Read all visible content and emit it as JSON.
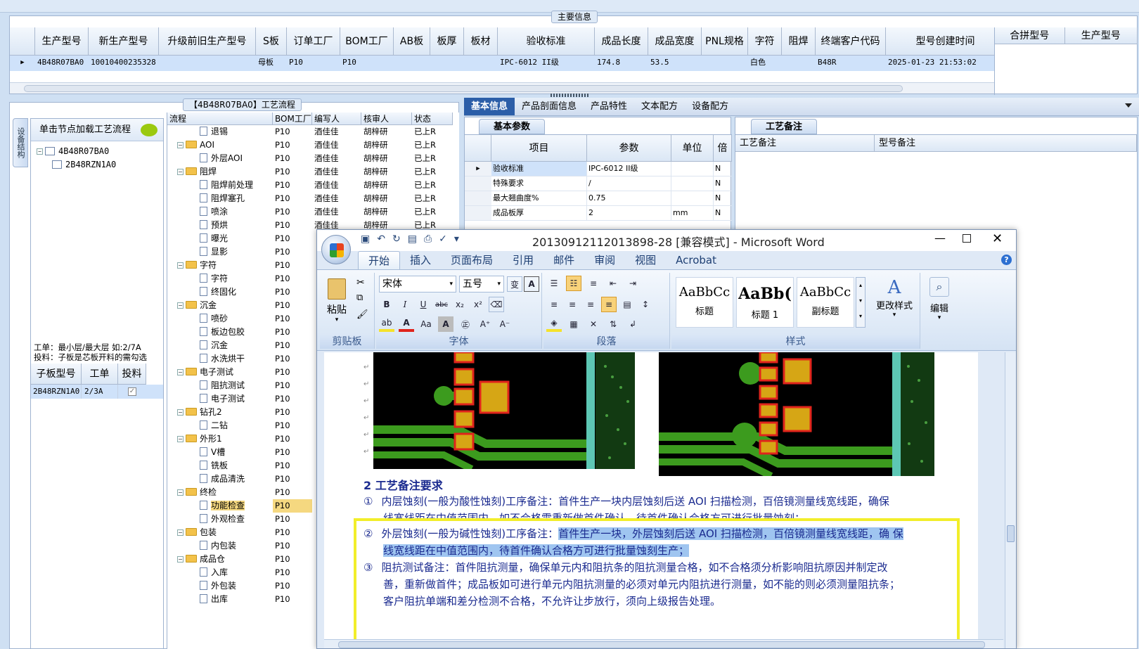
{
  "main_info_title": "主要信息",
  "main_grid": {
    "headers": [
      "生产型号",
      "新生产型号",
      "升级前旧生产型号",
      "S板",
      "订单工厂",
      "BOM工厂",
      "AB板",
      "板厚",
      "板材",
      "验收标准",
      "成品长度",
      "成品宽度",
      "PNL规格",
      "字符",
      "阻焊",
      "终端客户代码",
      "型号创建时间"
    ],
    "row": [
      "4B48R07BA0",
      "10010400235328",
      "",
      "母板",
      "P10",
      "P10",
      "",
      "",
      "",
      "IPC-6012 II级",
      "174.8",
      "53.5",
      "",
      "白色",
      "",
      "B48R",
      "2025-01-23 21:53:02"
    ]
  },
  "merge_grid": {
    "headers": [
      "合拼型号",
      "生产型号"
    ]
  },
  "flow_title": "【4B48R07BA0】工艺流程",
  "side_tab": "设备结构",
  "node_hint": "单击节点加载工艺流程",
  "node_tree": [
    "4B48R07BA0",
    "2B48RZN1A0"
  ],
  "work_note_1": "工单：最小层/最大层 如:2/7A",
  "work_note_2": "投料：子板是芯板开料的需勾选",
  "sub_grid": {
    "headers": [
      "子板型号",
      "工单",
      "投料"
    ],
    "row": [
      "2B48RZN1A0",
      "2/3A"
    ]
  },
  "flow_grid": {
    "headers": [
      "流程",
      "BOM工厂",
      "编写人",
      "核审人",
      "状态"
    ],
    "rows": [
      {
        "level": 2,
        "name": "退锡",
        "bom": "P10",
        "writer": "酒佳佳",
        "reviewer": "胡梓研",
        "status": "已上R"
      },
      {
        "level": 1,
        "name": "AOI",
        "bom": "P10",
        "writer": "酒佳佳",
        "reviewer": "胡梓研",
        "status": "已上R"
      },
      {
        "level": 2,
        "name": "外层AOI",
        "bom": "P10",
        "writer": "酒佳佳",
        "reviewer": "胡梓研",
        "status": "已上R"
      },
      {
        "level": 1,
        "name": "阻焊",
        "bom": "P10",
        "writer": "酒佳佳",
        "reviewer": "胡梓研",
        "status": "已上R"
      },
      {
        "level": 2,
        "name": "阻焊前处理",
        "bom": "P10",
        "writer": "酒佳佳",
        "reviewer": "胡梓研",
        "status": "已上R"
      },
      {
        "level": 2,
        "name": "阻焊塞孔",
        "bom": "P10",
        "writer": "酒佳佳",
        "reviewer": "胡梓研",
        "status": "已上R"
      },
      {
        "level": 2,
        "name": "喷涂",
        "bom": "P10",
        "writer": "酒佳佳",
        "reviewer": "胡梓研",
        "status": "已上R"
      },
      {
        "level": 2,
        "name": "预烘",
        "bom": "P10",
        "writer": "酒佳佳",
        "reviewer": "胡梓研",
        "status": "已上R"
      },
      {
        "level": 2,
        "name": "曝光",
        "bom": "P10",
        "writer": "",
        "reviewer": "",
        "status": ""
      },
      {
        "level": 2,
        "name": "显影",
        "bom": "P10",
        "writer": "",
        "reviewer": "",
        "status": ""
      },
      {
        "level": 1,
        "name": "字符",
        "bom": "P10",
        "writer": "",
        "reviewer": "",
        "status": ""
      },
      {
        "level": 2,
        "name": "字符",
        "bom": "P10",
        "writer": "",
        "reviewer": "",
        "status": ""
      },
      {
        "level": 2,
        "name": "终固化",
        "bom": "P10",
        "writer": "",
        "reviewer": "",
        "status": ""
      },
      {
        "level": 1,
        "name": "沉金",
        "bom": "P10",
        "writer": "",
        "reviewer": "",
        "status": ""
      },
      {
        "level": 2,
        "name": "喷砂",
        "bom": "P10",
        "writer": "",
        "reviewer": "",
        "status": ""
      },
      {
        "level": 2,
        "name": "板边包胶",
        "bom": "P10",
        "writer": "",
        "reviewer": "",
        "status": ""
      },
      {
        "level": 2,
        "name": "沉金",
        "bom": "P10",
        "writer": "",
        "reviewer": "",
        "status": ""
      },
      {
        "level": 2,
        "name": "水洗烘干",
        "bom": "P10",
        "writer": "",
        "reviewer": "",
        "status": ""
      },
      {
        "level": 1,
        "name": "电子测试",
        "bom": "P10",
        "writer": "",
        "reviewer": "",
        "status": ""
      },
      {
        "level": 2,
        "name": "阻抗测试",
        "bom": "P10",
        "writer": "",
        "reviewer": "",
        "status": ""
      },
      {
        "level": 2,
        "name": "电子测试",
        "bom": "P10",
        "writer": "",
        "reviewer": "",
        "status": ""
      },
      {
        "level": 1,
        "name": "钻孔2",
        "bom": "P10",
        "writer": "",
        "reviewer": "",
        "status": ""
      },
      {
        "level": 2,
        "name": "二钻",
        "bom": "P10",
        "writer": "",
        "reviewer": "",
        "status": ""
      },
      {
        "level": 1,
        "name": "外形1",
        "bom": "P10",
        "writer": "",
        "reviewer": "",
        "status": ""
      },
      {
        "level": 2,
        "name": "V槽",
        "bom": "P10",
        "writer": "",
        "reviewer": "",
        "status": ""
      },
      {
        "level": 2,
        "name": "铣板",
        "bom": "P10",
        "writer": "",
        "reviewer": "",
        "status": ""
      },
      {
        "level": 2,
        "name": "成品清洗",
        "bom": "P10",
        "writer": "",
        "reviewer": "",
        "status": ""
      },
      {
        "level": 1,
        "name": "终检",
        "bom": "P10",
        "writer": "",
        "reviewer": "",
        "status": ""
      },
      {
        "level": 2,
        "name": "功能检查",
        "bom": "P10",
        "writer": "",
        "reviewer": "",
        "status": "",
        "selected": true
      },
      {
        "level": 2,
        "name": "外观检查",
        "bom": "P10",
        "writer": "",
        "reviewer": "",
        "status": ""
      },
      {
        "level": 1,
        "name": "包装",
        "bom": "P10",
        "writer": "",
        "reviewer": "",
        "status": ""
      },
      {
        "level": 2,
        "name": "内包装",
        "bom": "P10",
        "writer": "",
        "reviewer": "",
        "status": ""
      },
      {
        "level": 1,
        "name": "成品仓",
        "bom": "P10",
        "writer": "",
        "reviewer": "",
        "status": ""
      },
      {
        "level": 2,
        "name": "入库",
        "bom": "P10",
        "writer": "",
        "reviewer": "",
        "status": ""
      },
      {
        "level": 2,
        "name": "外包装",
        "bom": "P10",
        "writer": "",
        "reviewer": "",
        "status": ""
      },
      {
        "level": 2,
        "name": "出库",
        "bom": "P10",
        "writer": "",
        "reviewer": "",
        "status": ""
      }
    ]
  },
  "right_tabs": [
    "基本信息",
    "产品剖面信息",
    "产品特性",
    "文本配方",
    "设备配方"
  ],
  "basic_params": {
    "title": "基本参数",
    "headers": [
      "项目",
      "参数",
      "单位",
      "倍"
    ],
    "rows": [
      [
        "验收标准",
        "IPC-6012 II级",
        "",
        "N"
      ],
      [
        "特殊要求",
        "/",
        "",
        "N"
      ],
      [
        "最大翘曲度%",
        "0.75",
        "",
        "N"
      ],
      [
        "成品板厚",
        "2",
        "mm",
        "N"
      ]
    ]
  },
  "remarks": {
    "title": "工艺备注",
    "col1": "工艺备注",
    "col2": "型号备注"
  },
  "word": {
    "title": "20130912112013898-28 [兼容模式] - Microsoft Word",
    "ribbon_tabs": [
      "开始",
      "插入",
      "页面布局",
      "引用",
      "邮件",
      "审阅",
      "视图",
      "Acrobat"
    ],
    "font_name": "宋体",
    "font_size": "五号",
    "paste_label": "粘贴",
    "groups": [
      "剪贴板",
      "字体",
      "段落",
      "样式"
    ],
    "styles": [
      {
        "sample": "AaBbCc",
        "label": "标题"
      },
      {
        "sample": "AaBb(",
        "label": "标题 1"
      },
      {
        "sample": "AaBbCc",
        "label": "副标题"
      }
    ],
    "change_style": "更改样式",
    "edit": "编辑",
    "heading": "2 工艺备注要求",
    "p1_num": "①",
    "p1": "内层蚀刻(一般为酸性蚀刻)工序备注：首件生产一块内层蚀刻后送 AOI 扫描检测，百倍镜测量线宽线距，确保",
    "p1b": "线宽线距在中值范围内，如不合格需重新做首件确认，待首件确认合格方可进行批量蚀刻；",
    "p2_num": "②",
    "p2a": "外层蚀刻(一般为碱性蚀刻)工序备注：",
    "p2b": "首件生产一块，外层蚀刻后送 AOI 扫描检测，百倍镜测量线宽线距，确 保",
    "p2c": "线宽线距在中值范围内，待首件确认合格方可进行批量蚀刻生产；",
    "p3_num": "③",
    "p3a": "阻抗测试备注：首件阻抗测量，确保单元内和阻抗条的阻抗测量合格，如不合格须分析影响阻抗原因并制定改",
    "p3b": "善，重新做首件；成品板如可进行单元内阻抗测量的必须对单元内阻抗进行测量，如不能的则必须测量阻抗条；",
    "p3c": "客户阻抗单端和差分检测不合格，不允许让步放行，须向上级报告处理。"
  },
  "colors": {
    "selected_row": "#cfe2fa",
    "highlight": "#9fc5f0",
    "callout": "#f2ee2a",
    "pcb_bg": "#000000",
    "pcb_trace": "#3c9b1e",
    "pcb_pad": "#d6a615",
    "pcb_pad_edge": "#e0241c"
  }
}
